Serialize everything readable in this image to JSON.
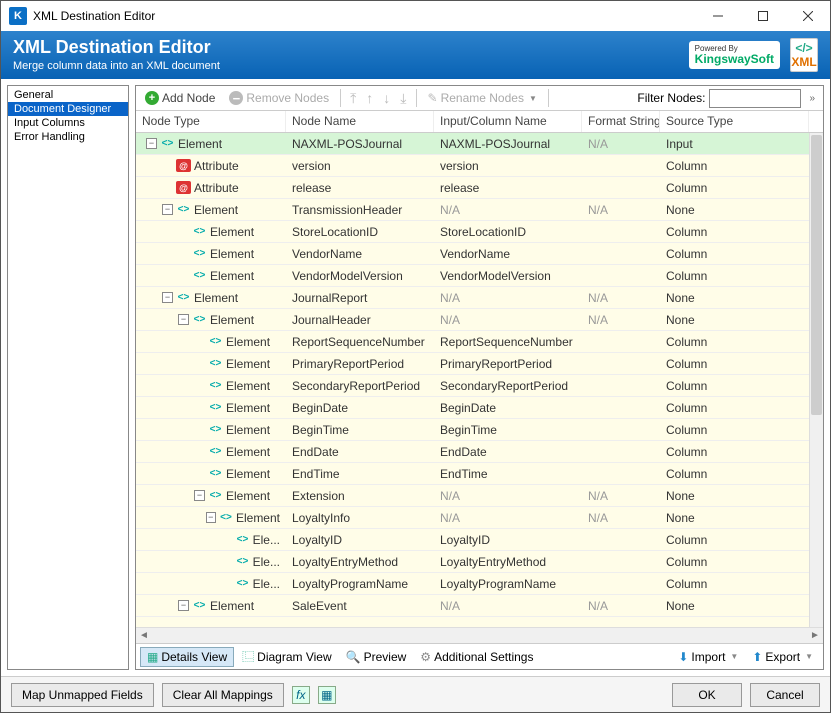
{
  "titlebar": {
    "title": "XML Destination Editor"
  },
  "header": {
    "title": "XML Destination Editor",
    "subtitle": "Merge column data into an XML document",
    "logo_powered": "Powered By",
    "logo_name": "KingswaySoft",
    "xml_label": "XML"
  },
  "sidebar": {
    "items": [
      "General",
      "Document Designer",
      "Input Columns",
      "Error Handling"
    ],
    "selected": 1
  },
  "toolbar": {
    "add": "Add Node",
    "remove": "Remove Nodes",
    "rename": "Rename Nodes",
    "filter_label": "Filter Nodes:",
    "filter_value": ""
  },
  "columns": {
    "type": "Node Type",
    "name": "Node Name",
    "input": "Input/Column Name",
    "fmt": "Format String",
    "src": "Source Type"
  },
  "na": "N/A",
  "rows": [
    {
      "depth": 0,
      "exp": "-",
      "kind": "element",
      "label": "Element",
      "name": "NAXML-POSJournal",
      "input": "NAXML-POSJournal",
      "fmt": "N/A",
      "src": "Input",
      "sel": true
    },
    {
      "depth": 1,
      "exp": "",
      "kind": "attr",
      "label": "Attribute",
      "name": "version",
      "input": "version",
      "fmt": "",
      "src": "Column"
    },
    {
      "depth": 1,
      "exp": "",
      "kind": "attr",
      "label": "Attribute",
      "name": "release",
      "input": "release",
      "fmt": "",
      "src": "Column"
    },
    {
      "depth": 1,
      "exp": "-",
      "kind": "element",
      "label": "Element",
      "name": "TransmissionHeader",
      "input": "N/A",
      "fmt": "N/A",
      "src": "None"
    },
    {
      "depth": 2,
      "exp": "",
      "kind": "element",
      "label": "Element",
      "name": "StoreLocationID",
      "input": "StoreLocationID",
      "fmt": "",
      "src": "Column"
    },
    {
      "depth": 2,
      "exp": "",
      "kind": "element",
      "label": "Element",
      "name": "VendorName",
      "input": "VendorName",
      "fmt": "",
      "src": "Column"
    },
    {
      "depth": 2,
      "exp": "",
      "kind": "element",
      "label": "Element",
      "name": "VendorModelVersion",
      "input": "VendorModelVersion",
      "fmt": "",
      "src": "Column"
    },
    {
      "depth": 1,
      "exp": "-",
      "kind": "element",
      "label": "Element",
      "name": "JournalReport",
      "input": "N/A",
      "fmt": "N/A",
      "src": "None"
    },
    {
      "depth": 2,
      "exp": "-",
      "kind": "element",
      "label": "Element",
      "name": "JournalHeader",
      "input": "N/A",
      "fmt": "N/A",
      "src": "None"
    },
    {
      "depth": 3,
      "exp": "",
      "kind": "element",
      "label": "Element",
      "name": "ReportSequenceNumber",
      "input": "ReportSequenceNumber",
      "fmt": "",
      "src": "Column"
    },
    {
      "depth": 3,
      "exp": "",
      "kind": "element",
      "label": "Element",
      "name": "PrimaryReportPeriod",
      "input": "PrimaryReportPeriod",
      "fmt": "",
      "src": "Column"
    },
    {
      "depth": 3,
      "exp": "",
      "kind": "element",
      "label": "Element",
      "name": "SecondaryReportPeriod",
      "input": "SecondaryReportPeriod",
      "fmt": "",
      "src": "Column"
    },
    {
      "depth": 3,
      "exp": "",
      "kind": "element",
      "label": "Element",
      "name": "BeginDate",
      "input": "BeginDate",
      "fmt": "",
      "src": "Column"
    },
    {
      "depth": 3,
      "exp": "",
      "kind": "element",
      "label": "Element",
      "name": "BeginTime",
      "input": "BeginTime",
      "fmt": "",
      "src": "Column"
    },
    {
      "depth": 3,
      "exp": "",
      "kind": "element",
      "label": "Element",
      "name": "EndDate",
      "input": "EndDate",
      "fmt": "",
      "src": "Column"
    },
    {
      "depth": 3,
      "exp": "",
      "kind": "element",
      "label": "Element",
      "name": "EndTime",
      "input": "EndTime",
      "fmt": "",
      "src": "Column"
    },
    {
      "depth": 3,
      "exp": "-",
      "kind": "element",
      "label": "Element",
      "name": "Extension",
      "input": "N/A",
      "fmt": "N/A",
      "src": "None"
    },
    {
      "depth": 4,
      "exp": "-",
      "kind": "element",
      "label": "Element",
      "name": "LoyaltyInfo",
      "input": "N/A",
      "fmt": "N/A",
      "src": "None"
    },
    {
      "depth": 5,
      "exp": "",
      "kind": "element",
      "label": "Ele...",
      "name": "LoyaltyID",
      "input": "LoyaltyID",
      "fmt": "",
      "src": "Column"
    },
    {
      "depth": 5,
      "exp": "",
      "kind": "element",
      "label": "Ele...",
      "name": "LoyaltyEntryMethod",
      "input": "LoyaltyEntryMethod",
      "fmt": "",
      "src": "Column"
    },
    {
      "depth": 5,
      "exp": "",
      "kind": "element",
      "label": "Ele...",
      "name": "LoyaltyProgramName",
      "input": "LoyaltyProgramName",
      "fmt": "",
      "src": "Column"
    },
    {
      "depth": 2,
      "exp": "-",
      "kind": "element",
      "label": "Element",
      "name": "SaleEvent",
      "input": "N/A",
      "fmt": "N/A",
      "src": "None"
    }
  ],
  "bottom": {
    "details": "Details View",
    "diagram": "Diagram View",
    "preview": "Preview",
    "additional": "Additional Settings",
    "import": "Import",
    "export": "Export"
  },
  "footer": {
    "map": "Map Unmapped Fields",
    "clear": "Clear All Mappings",
    "ok": "OK",
    "cancel": "Cancel"
  }
}
